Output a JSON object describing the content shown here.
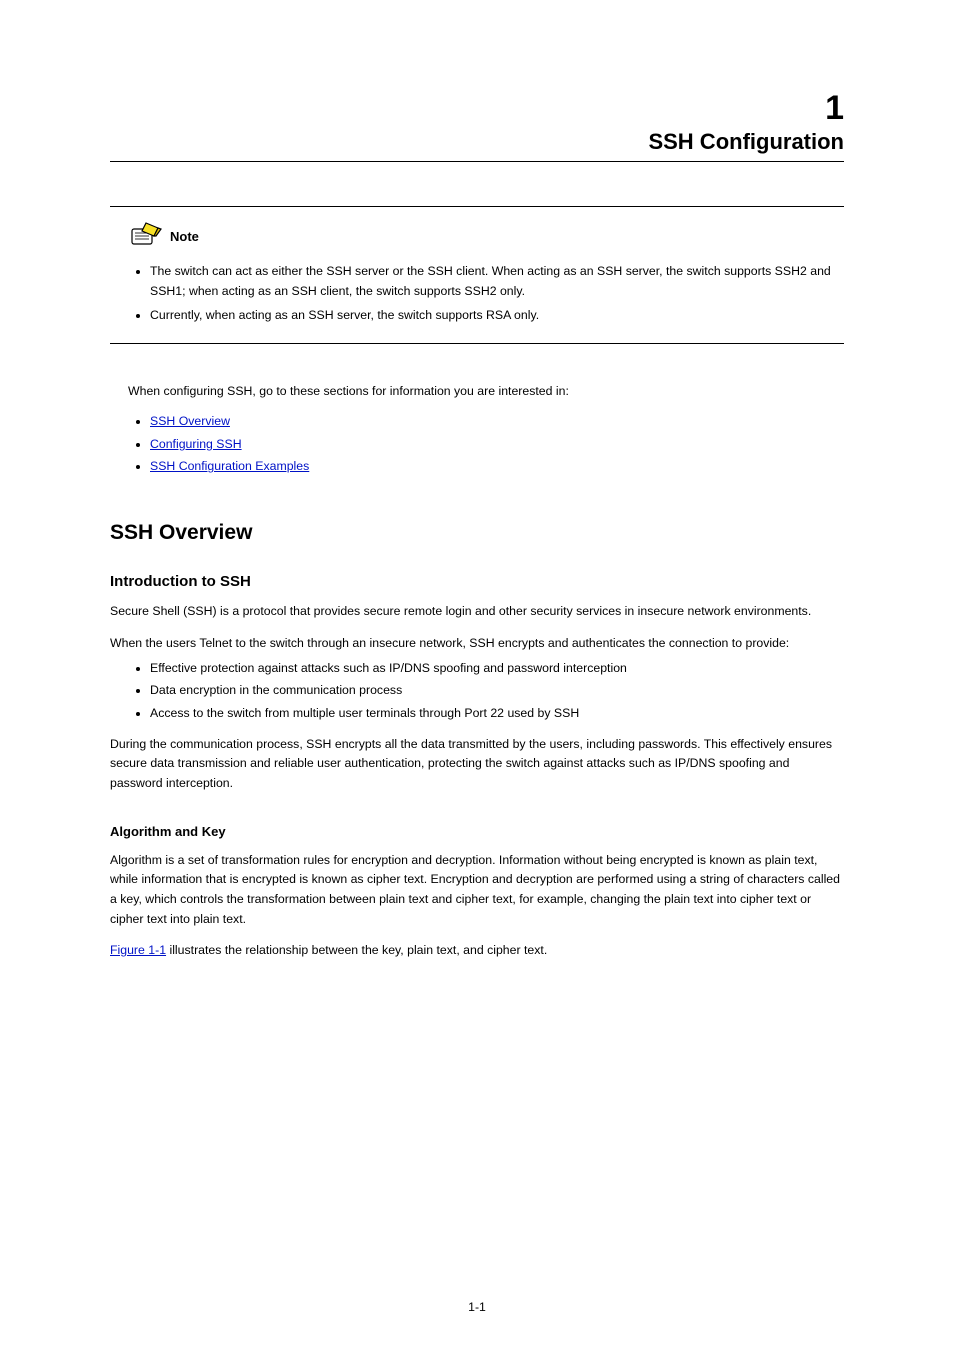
{
  "chapter": {
    "number": "1",
    "title": "SSH Configuration"
  },
  "note": {
    "label": "Note",
    "items": [
      "The switch can act as either the SSH server or the SSH client. When acting as an SSH server, the switch supports SSH2 and SSH1; when acting as an SSH client, the switch supports SSH2 only.",
      "Currently, when acting as an SSH server, the switch supports RSA only."
    ]
  },
  "intro_line": "When configuring SSH, go to these sections for information you are interested in:",
  "toc": [
    {
      "label": "SSH Overview"
    },
    {
      "label": "Configuring SSH"
    },
    {
      "label": "SSH Configuration Examples"
    }
  ],
  "sections": {
    "h1": "SSH Overview",
    "h2": "Introduction to SSH",
    "p1": "Secure Shell (SSH) is a protocol that provides secure remote login and other security services in insecure network environments.",
    "p2": "When the users Telnet to the switch through an insecure network, SSH encrypts and authenticates the connection to provide:",
    "features": [
      "Effective protection against attacks such as IP/DNS spoofing and password interception",
      "Data encryption in the communication process",
      "Access to the switch from multiple user terminals through Port 22 used by SSH"
    ],
    "p3": "During the communication process, SSH encrypts all the data transmitted by the users, including passwords. This effectively ensures secure data transmission and reliable user authentication, protecting the switch against attacks such as IP/DNS spoofing and password interception.",
    "h3": "Algorithm and Key",
    "p4": "Algorithm is a set of transformation rules for encryption and decryption. Information without being encrypted is known as plain text, while information that is encrypted is known as cipher text. Encryption and decryption are performed using a string of characters called a key, which controls the transformation between plain text and cipher text, for example, changing the plain text into cipher text or cipher text into plain text."
  },
  "figure_ref": "Figure 1-1",
  "figure_sentence_prefix": " illustrates the relationship between the key, plain text, and cipher text.",
  "page_number": "1-1"
}
